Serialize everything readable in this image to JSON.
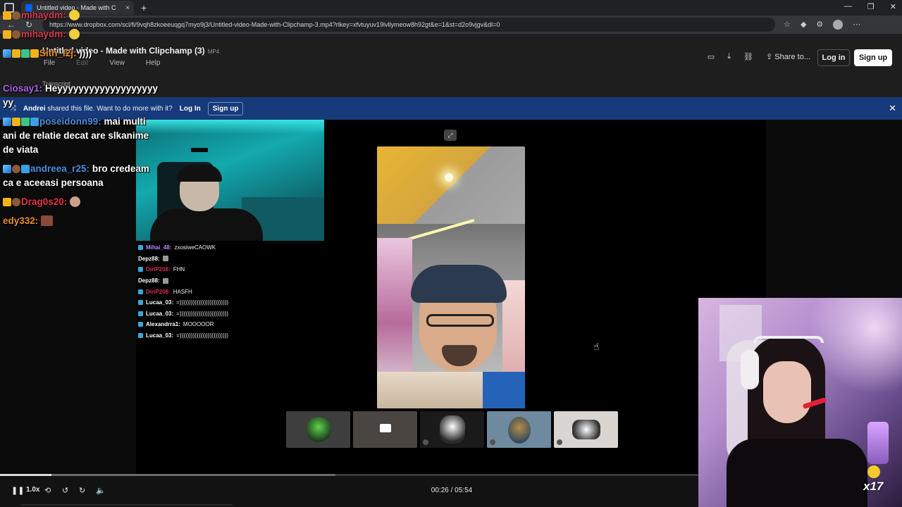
{
  "browser": {
    "tab_title": "Untitled video - Made with C",
    "tab_close": "×",
    "new_tab": "+",
    "url": "https://www.dropbox.com/scl/fi/9vqh8zkoeeuqgq7myo9j3/Untitled-video-Made-with-Clipchamp-3.mp4?rlkey=xfvtuyuv19lvllymeow8h92gt&e=1&st=d2o9vjgv&dl=0",
    "window_controls": [
      "—",
      "❐",
      "✕"
    ]
  },
  "file": {
    "title": "Untitled video - Made with Clipchamp (3)",
    "type": "MP4",
    "menu": [
      "File",
      "Edit",
      "View",
      "Help"
    ],
    "transcript": "Transcript"
  },
  "header_actions": {
    "share_label": "Share to...",
    "login_label": "Log in",
    "signup_label": "Sign up"
  },
  "banner": {
    "sharer": "Andrei",
    "message": "shared this file. Want to do more with it?",
    "login_label": "Log In",
    "signup_label": "Sign up"
  },
  "overlay_chat": [
    {
      "user": "mihaydm:",
      "text": ""
    },
    {
      "user": "mihaydm:",
      "text": ""
    },
    {
      "user": "Sith_l2j:",
      "text": "))))"
    },
    {
      "user": "Ciosay1:",
      "text": "Heyyyyyyyyyyyyyyyyyyy"
    },
    {
      "user": "",
      "text": "yy"
    },
    {
      "user": "poseidonn99:",
      "text": "mai multi"
    },
    {
      "user": "",
      "text": "ani de relatie decat are slkanime"
    },
    {
      "user": "",
      "text": "de viata"
    },
    {
      "user": "andreea_r25:",
      "text": "bro credeam"
    },
    {
      "user": "",
      "text": "ca e aceeasi persoana"
    },
    {
      "user": "Drag0s20:",
      "text": ""
    },
    {
      "user": "edy332:",
      "text": ""
    }
  ],
  "stream_chat": [
    {
      "user": "Mihai_48:",
      "text": "zxosiweCAOWK"
    },
    {
      "user": "Depz88:",
      "text": ""
    },
    {
      "user": "DiriP208:",
      "text": "FHN"
    },
    {
      "user": "Depz88:",
      "text": ""
    },
    {
      "user": "DiriP208:",
      "text": "HASFH"
    },
    {
      "user": "Lucaa_03:",
      "text": "=))))))))))))))))))))))))))"
    },
    {
      "user": "Lucaa_03:",
      "text": "=))))))))))))))))))))))))))"
    },
    {
      "user": "Alexandrra1:",
      "text": "MOOOOOR"
    },
    {
      "user": "Lucaa_03:",
      "text": "=))))))))))))))))))))))))))"
    }
  ],
  "streamer_counter": "x17",
  "player": {
    "speed": "1.0x",
    "current_time": "00:26",
    "total_time": "05:54",
    "time_separator": " / ",
    "progress_fraction": 0.0734,
    "buffer_fraction": 0.48
  }
}
